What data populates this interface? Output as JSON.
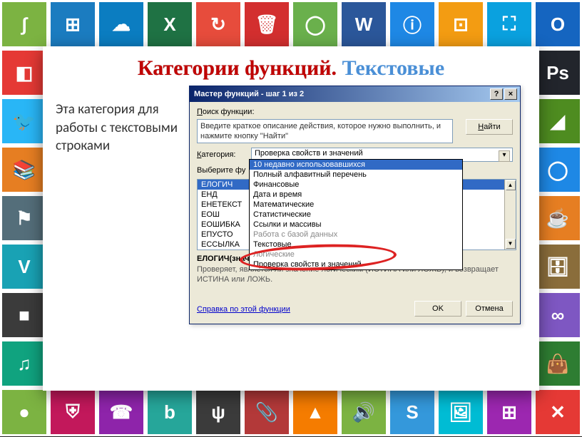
{
  "slide": {
    "title_part1": "Категории функций.",
    "title_part2": " Текстовые",
    "body_text": "Эта категория для работы с текстовыми строками"
  },
  "dialog": {
    "title": "Мастер функций - шаг 1 из 2",
    "help_btn": "?",
    "close_btn": "×",
    "search_label": "Поиск функции:",
    "search_value": "Введите краткое описание действия, которое нужно выполнить, и нажмите кнопку \"Найти\"",
    "find_btn": "Найти",
    "category_label": "Категория:",
    "category_value": "Проверка свойств и значений",
    "listbox_label": "Выберите фу",
    "dropdown_items": [
      "10 недавно использовавшихся",
      "Полный алфавитный перечень",
      "Финансовые",
      "Дата и время",
      "Математические",
      "Статистические",
      "Ссылки и массивы",
      "Работа с базой данных",
      "Текстовые",
      "Логические",
      "Проверка свойств и значений"
    ],
    "dropdown_selected_index": 0,
    "functions": [
      "ЕЛОГИЧ",
      "ЕНД",
      "ЕНЕТЕКСТ",
      "ЕОШ",
      "ЕОШИБКА",
      "ЕПУСТО",
      "ЕССЫЛКА"
    ],
    "function_selected_index": 0,
    "signature": "ЕЛОГИЧ(значение)",
    "description": "Проверяет, является ли значение логическим (ИСТИНА или ЛОЖЬ), и возвращает ИСТИНА или ЛОЖЬ.",
    "help_link": "Справка по этой функции",
    "ok_btn": "OK",
    "cancel_btn": "Отмена"
  },
  "tile_colors": [
    [
      "#7cb342",
      "#1b7cc0",
      "#0b7dc1",
      "#1f7244",
      "#e74c3c",
      "#d32f2f",
      "#6ab04c",
      "#2b579a",
      "#1e88e5",
      "#f39c12",
      "#0aa1df",
      "#1565c0"
    ],
    [
      "#e53935",
      "#ffffff",
      "#ffffff",
      "#ffffff",
      "#ffffff",
      "#ffffff",
      "#ffffff",
      "#ffffff",
      "#ffffff",
      "#ffffff",
      "#ffffff",
      "#22252c"
    ],
    [
      "#29b6f6",
      "#ffffff",
      "#ffffff",
      "#ffffff",
      "#ffffff",
      "#ffffff",
      "#ffffff",
      "#ffffff",
      "#ffffff",
      "#ffffff",
      "#ffffff",
      "#4e8c20"
    ],
    [
      "#e67e22",
      "#ffffff",
      "#ffffff",
      "#ffffff",
      "#ffffff",
      "#ffffff",
      "#ffffff",
      "#ffffff",
      "#ffffff",
      "#ffffff",
      "#ffffff",
      "#1e88e5"
    ],
    [
      "#546e7a",
      "#ffffff",
      "#ffffff",
      "#ffffff",
      "#ffffff",
      "#ffffff",
      "#ffffff",
      "#ffffff",
      "#ffffff",
      "#ffffff",
      "#ffffff",
      "#e67e22"
    ],
    [
      "#19a2b4",
      "#ffffff",
      "#ffffff",
      "#ffffff",
      "#ffffff",
      "#ffffff",
      "#ffffff",
      "#ffffff",
      "#ffffff",
      "#ffffff",
      "#ffffff",
      "#8a6d3b"
    ],
    [
      "#3b3b3b",
      "#ffffff",
      "#ffffff",
      "#ffffff",
      "#ffffff",
      "#ffffff",
      "#ffffff",
      "#ffffff",
      "#ffffff",
      "#ffffff",
      "#ffffff",
      "#7e57c2"
    ],
    [
      "#10a37f",
      "#ffffff",
      "#ffffff",
      "#ffffff",
      "#ffffff",
      "#ffffff",
      "#ffffff",
      "#ffffff",
      "#ffffff",
      "#ffffff",
      "#ffffff",
      "#2e7d32"
    ],
    [
      "#7cb342",
      "#c2185b",
      "#8e24aa",
      "#26a69a",
      "#3b3b3b",
      "#b33939",
      "#f57c00",
      "#7cb342",
      "#3498db",
      "#00bcd4",
      "#9c27b0",
      "#e53935"
    ]
  ],
  "tile_labels": [
    [
      "swirl",
      "windows-logo",
      "cloud",
      "excel",
      "share-arrow",
      "trash",
      "xbox",
      "word",
      "info-circle",
      "dashboard",
      "shop",
      "opera"
    ],
    [
      "office",
      "",
      "",
      "",
      "",
      "",
      "",
      "",
      "",
      "",
      "",
      "photoshop"
    ],
    [
      "twitter",
      "",
      "",
      "",
      "",
      "",
      "",
      "",
      "",
      "",
      "",
      "deviantart"
    ],
    [
      "winrar",
      "",
      "",
      "",
      "",
      "",
      "",
      "",
      "",
      "",
      "",
      "circle-o"
    ],
    [
      "flag",
      "",
      "",
      "",
      "",
      "",
      "",
      "",
      "",
      "",
      "",
      "java"
    ],
    [
      "vimeo",
      "",
      "",
      "",
      "",
      "",
      "",
      "",
      "",
      "",
      "",
      "archive"
    ],
    [
      "apple",
      "",
      "",
      "",
      "",
      "",
      "",
      "",
      "",
      "",
      "",
      "visual-studio"
    ],
    [
      "music-note",
      "",
      "",
      "",
      "",
      "",
      "",
      "",
      "",
      "",
      "",
      "bag"
    ],
    [
      "spotify",
      "shield",
      "phone",
      "bing",
      "usb",
      "paperclip",
      "google-drive",
      "audio",
      "skype",
      "picture",
      "windows-store",
      "close-x"
    ]
  ]
}
